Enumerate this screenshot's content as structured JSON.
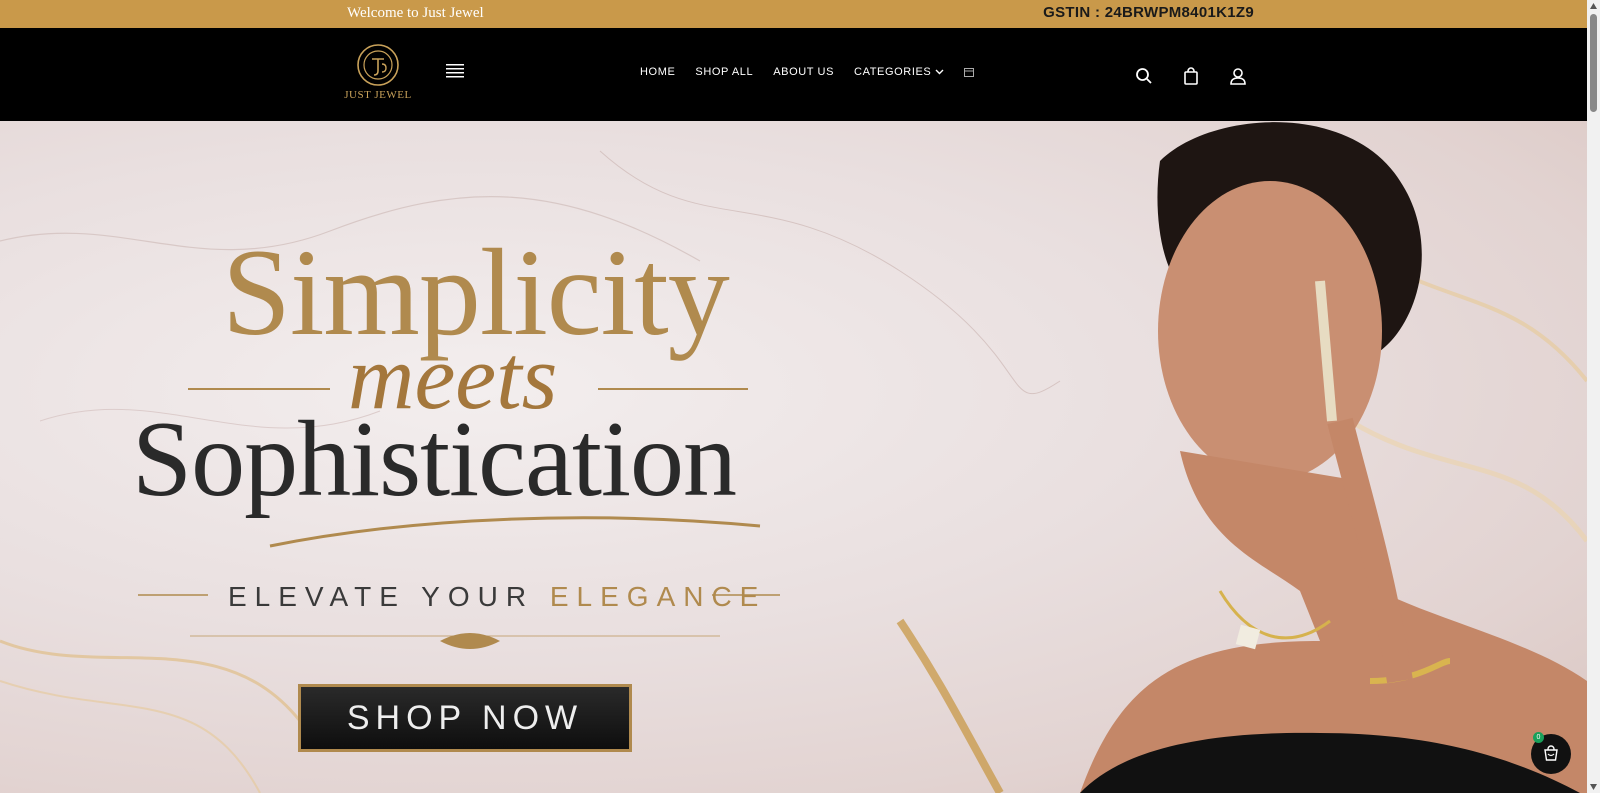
{
  "announcement": {
    "welcome": "Welcome to Just Jewel",
    "gstin": "GSTIN : 24BRWPM8401K1Z9"
  },
  "header": {
    "logo_text": "JUST JEWEL",
    "nav": [
      {
        "label": "HOME"
      },
      {
        "label": "SHOP ALL"
      },
      {
        "label": "ABOUT US"
      },
      {
        "label": "CATEGORIES"
      }
    ],
    "icons": [
      "menu-icon",
      "calendar-icon",
      "search-icon",
      "bag-icon",
      "account-icon"
    ]
  },
  "hero": {
    "headline_1": "Simplicity",
    "headline_2": "meets",
    "headline_3": "Sophistication",
    "tagline_a": "ELEVATE YOUR",
    "tagline_b": "ELEGANCE",
    "cta": "SHOP NOW"
  },
  "floating_cart": {
    "count": "0"
  },
  "colors": {
    "announcement_bg": "#c9994a",
    "header_bg": "#000000",
    "gold": "#b08a4e"
  }
}
